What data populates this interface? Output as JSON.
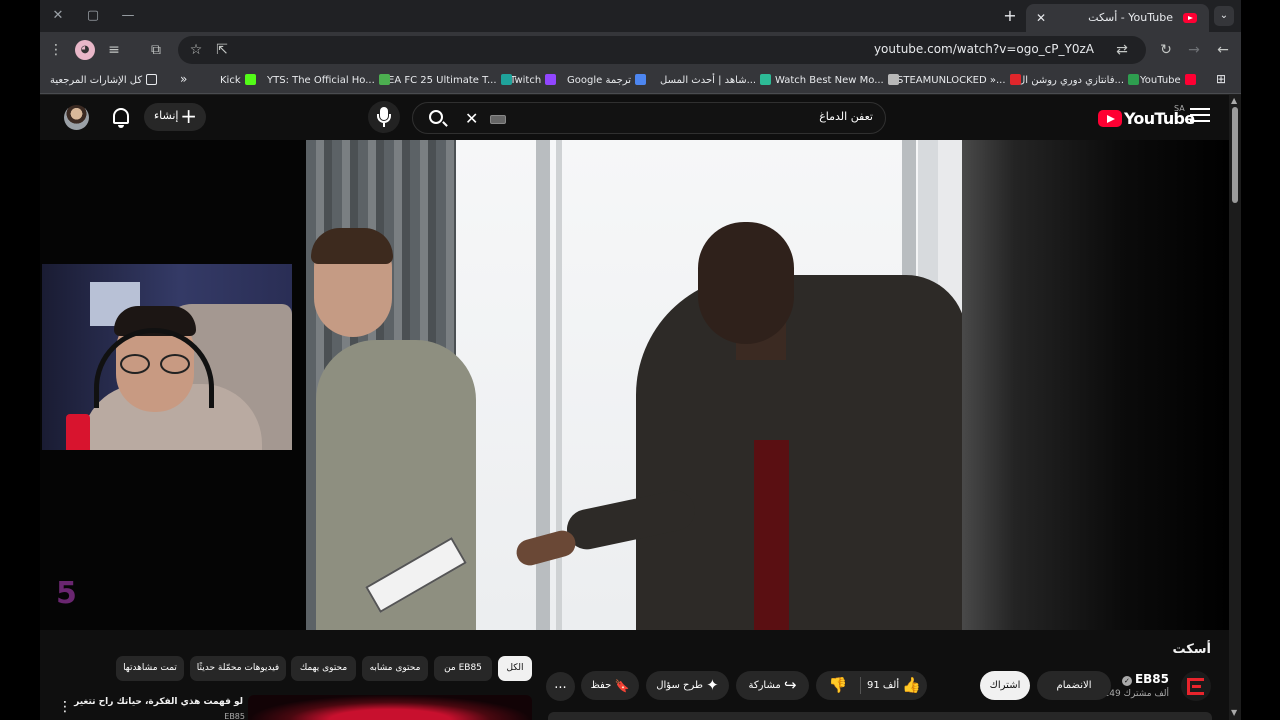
{
  "browser": {
    "tab_title": "أسكت - YouTube",
    "url": "youtube.com/watch?v=ogo_cP_Y0zA",
    "window_controls": {
      "minimize": "—",
      "maximize": "▢",
      "close": "✕"
    },
    "new_tab": "+",
    "tab_close": "✕",
    "tab_search": "⌄"
  },
  "bookmarks": [
    {
      "label": "YouTube",
      "color": "#ff0033"
    },
    {
      "label": "فانتازي دوري روشن ال...",
      "color": "#2e9e4f"
    },
    {
      "label": "STEAMUNLOCKED »...",
      "color": "#e0262b"
    },
    {
      "label": "Watch Best New Mo...",
      "color": "#b8b8b8"
    },
    {
      "label": "شاهد | أحدث المسل...",
      "color": "#2dbb96"
    },
    {
      "label": "Google ترجمة",
      "color": "#4d86f0"
    },
    {
      "label": "Twitch",
      "color": "#9146ff"
    },
    {
      "label": "EA FC 25 Ultimate T...",
      "color": "#1fa39b"
    },
    {
      "label": "YTS: The Official Ho...",
      "color": "#4caf50"
    },
    {
      "label": "Kick",
      "color": "#53fc18"
    }
  ],
  "bookmarks_overflow": "»",
  "all_bookmarks": "كل الإشارات المرجعية",
  "youtube": {
    "logo": "YouTube",
    "region": "SA",
    "search_value": "تعفن الدماغ",
    "create_label": "إنشاء",
    "create_plus": "+"
  },
  "overlay": {
    "five_logo": "5"
  },
  "video": {
    "title": "أسكت",
    "channel": "EB85",
    "verified_mark": "✓",
    "subscribers": "149 ألف مشترك",
    "subscribe_label": "اشتراك",
    "join_label": "الانضمام",
    "likes": "91 ألف",
    "like_icon": "👍",
    "dislike_icon": "👎",
    "share_label": "مشاركة",
    "share_icon": "↪",
    "ask_label": "طرح سؤال",
    "ask_icon": "✦",
    "save_label": "حفظ",
    "save_icon": "🔖",
    "more_label": "..."
  },
  "chips": [
    "الكل",
    "من EB85",
    "محتوى مشابه",
    "محتوى يهمك",
    "فيديوهات محمّلة حديثًا",
    "تمت مشاهدتها"
  ],
  "recommendation": {
    "title": "لو فهمت هذي الفكرة، حياتك راح تتغير",
    "channel": "EB85",
    "menu": "⋮"
  },
  "scrollbar": {
    "up": "▲",
    "down": "▼"
  }
}
